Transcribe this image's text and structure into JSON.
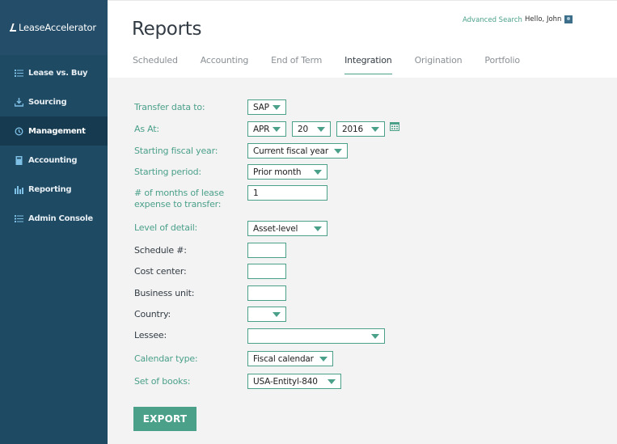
{
  "brand": {
    "logo_text": "LeaseAccelerator"
  },
  "sidebar": {
    "items": [
      {
        "label": "Lease vs. Buy",
        "icon": "list-icon",
        "active": false
      },
      {
        "label": "Sourcing",
        "icon": "download-icon",
        "active": false
      },
      {
        "label": "Management",
        "icon": "history-icon",
        "active": true
      },
      {
        "label": "Accounting",
        "icon": "calculator-icon",
        "active": false
      },
      {
        "label": "Reporting",
        "icon": "bar-chart-icon",
        "active": false
      },
      {
        "label": "Admin Console",
        "icon": "list-icon",
        "active": false
      }
    ]
  },
  "header": {
    "title": "Reports",
    "advanced_search": "Advanced Search",
    "greeting": "Hello, John",
    "tabs": [
      {
        "label": "Scheduled",
        "active": false
      },
      {
        "label": "Accounting",
        "active": false
      },
      {
        "label": "End of Term",
        "active": false
      },
      {
        "label": "Integration",
        "active": true
      },
      {
        "label": "Origination",
        "active": false
      },
      {
        "label": "Portfolio",
        "active": false
      }
    ]
  },
  "form": {
    "transfer_to": {
      "label": "Transfer data to:",
      "value": "SAP"
    },
    "as_at": {
      "label": "As At:",
      "month": "APR",
      "day": "20",
      "year": "2016"
    },
    "starting_fiscal_year": {
      "label": "Starting fiscal year:",
      "value": "Current fiscal year"
    },
    "starting_period": {
      "label": "Starting period:",
      "value": "Prior month"
    },
    "months_expense": {
      "label_line1": "# of months of lease",
      "label_line2": "expense to transfer:",
      "value": "1"
    },
    "level_of_detail": {
      "label": "Level of detail:",
      "value": "Asset-level"
    },
    "schedule": {
      "label": "Schedule #:",
      "value": ""
    },
    "cost_center": {
      "label": "Cost center:",
      "value": ""
    },
    "business_unit": {
      "label": "Business unit:",
      "value": ""
    },
    "country": {
      "label": "Country:",
      "value": ""
    },
    "lessee": {
      "label": "Lessee:",
      "value": ""
    },
    "calendar_type": {
      "label": "Calendar type:",
      "value": "Fiscal calendar"
    },
    "set_of_books": {
      "label": "Set of books:",
      "value": "USA-Entityl-840"
    },
    "export_label": "EXPORT"
  },
  "colors": {
    "sidebar_bg": "#1f4a63",
    "sidebar_active": "#163a50",
    "accent": "#4ba08a",
    "icon_blue": "#7fc0e6"
  }
}
